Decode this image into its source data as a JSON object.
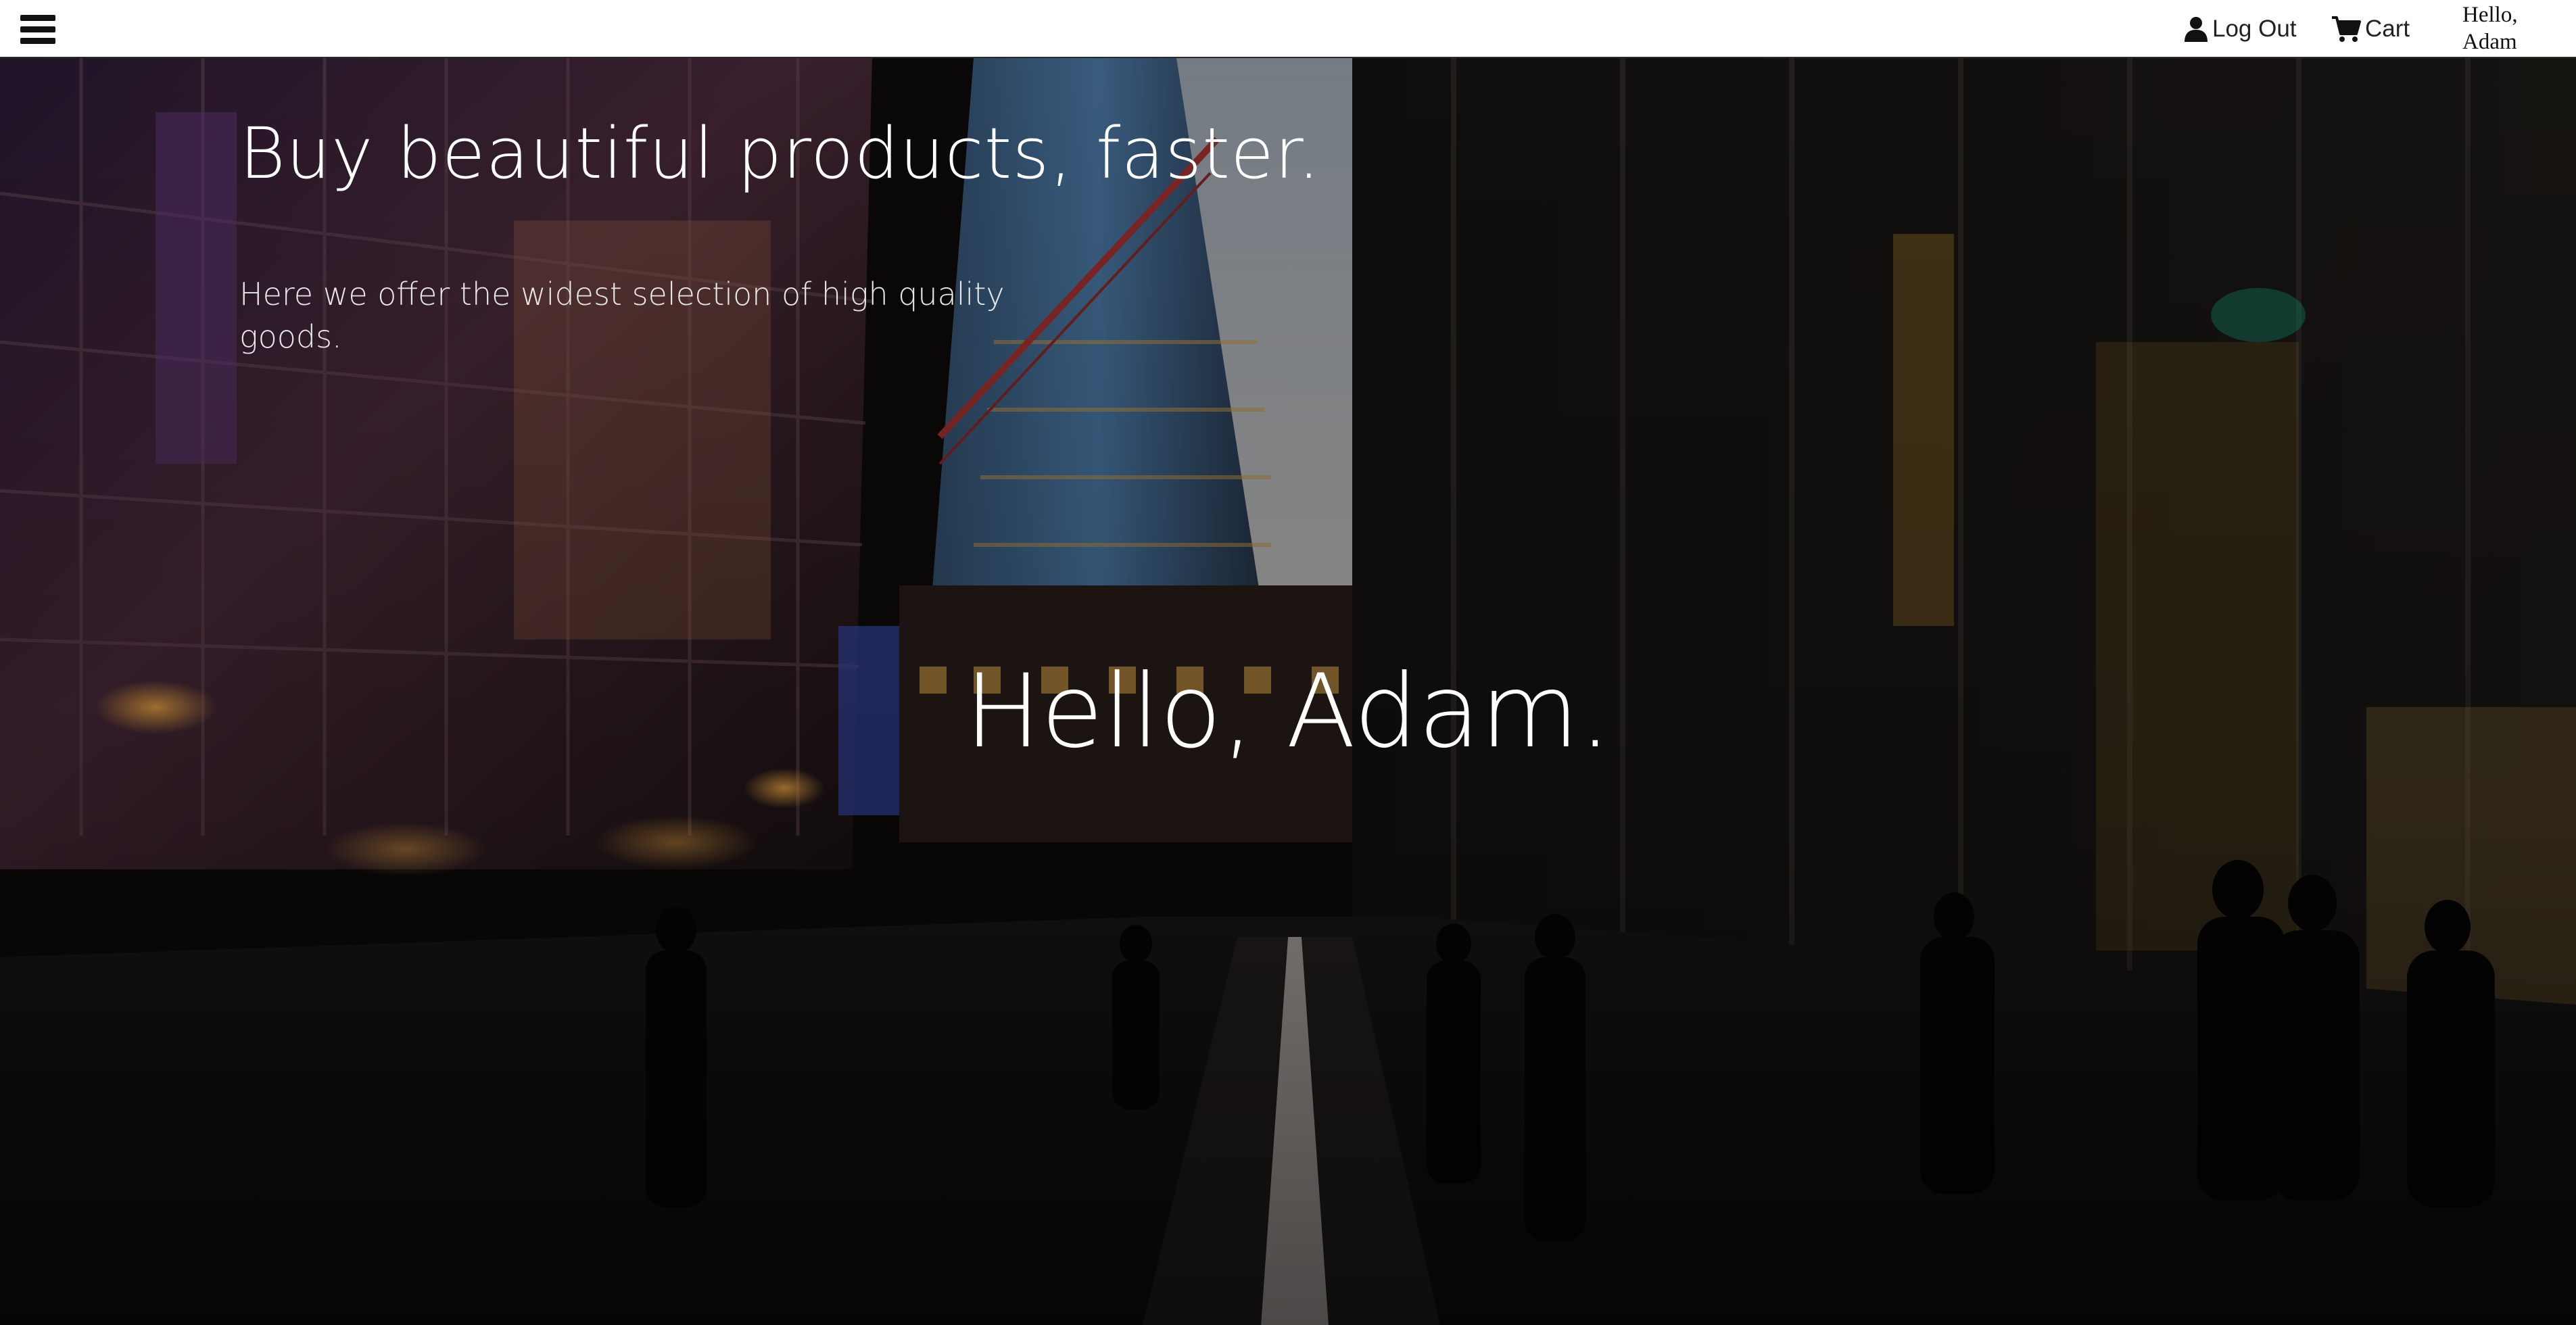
{
  "nav": {
    "menu_icon": "hamburger-menu-icon",
    "logout_icon": "user-icon",
    "logout_label": "Log Out",
    "cart_icon": "cart-icon",
    "cart_label": "Cart",
    "greeting": "Hello, Adam"
  },
  "hero": {
    "title": "Buy beautiful products, faster.",
    "subtitle": "Here we offer the widest selection of high quality goods.",
    "greeting": "Hello, Adam.",
    "background_image": "night-city-street-photo"
  },
  "colors": {
    "nav_background": "#ffffff",
    "hero_text": "#ffffff",
    "hero_overlay": "#0c0a09"
  }
}
